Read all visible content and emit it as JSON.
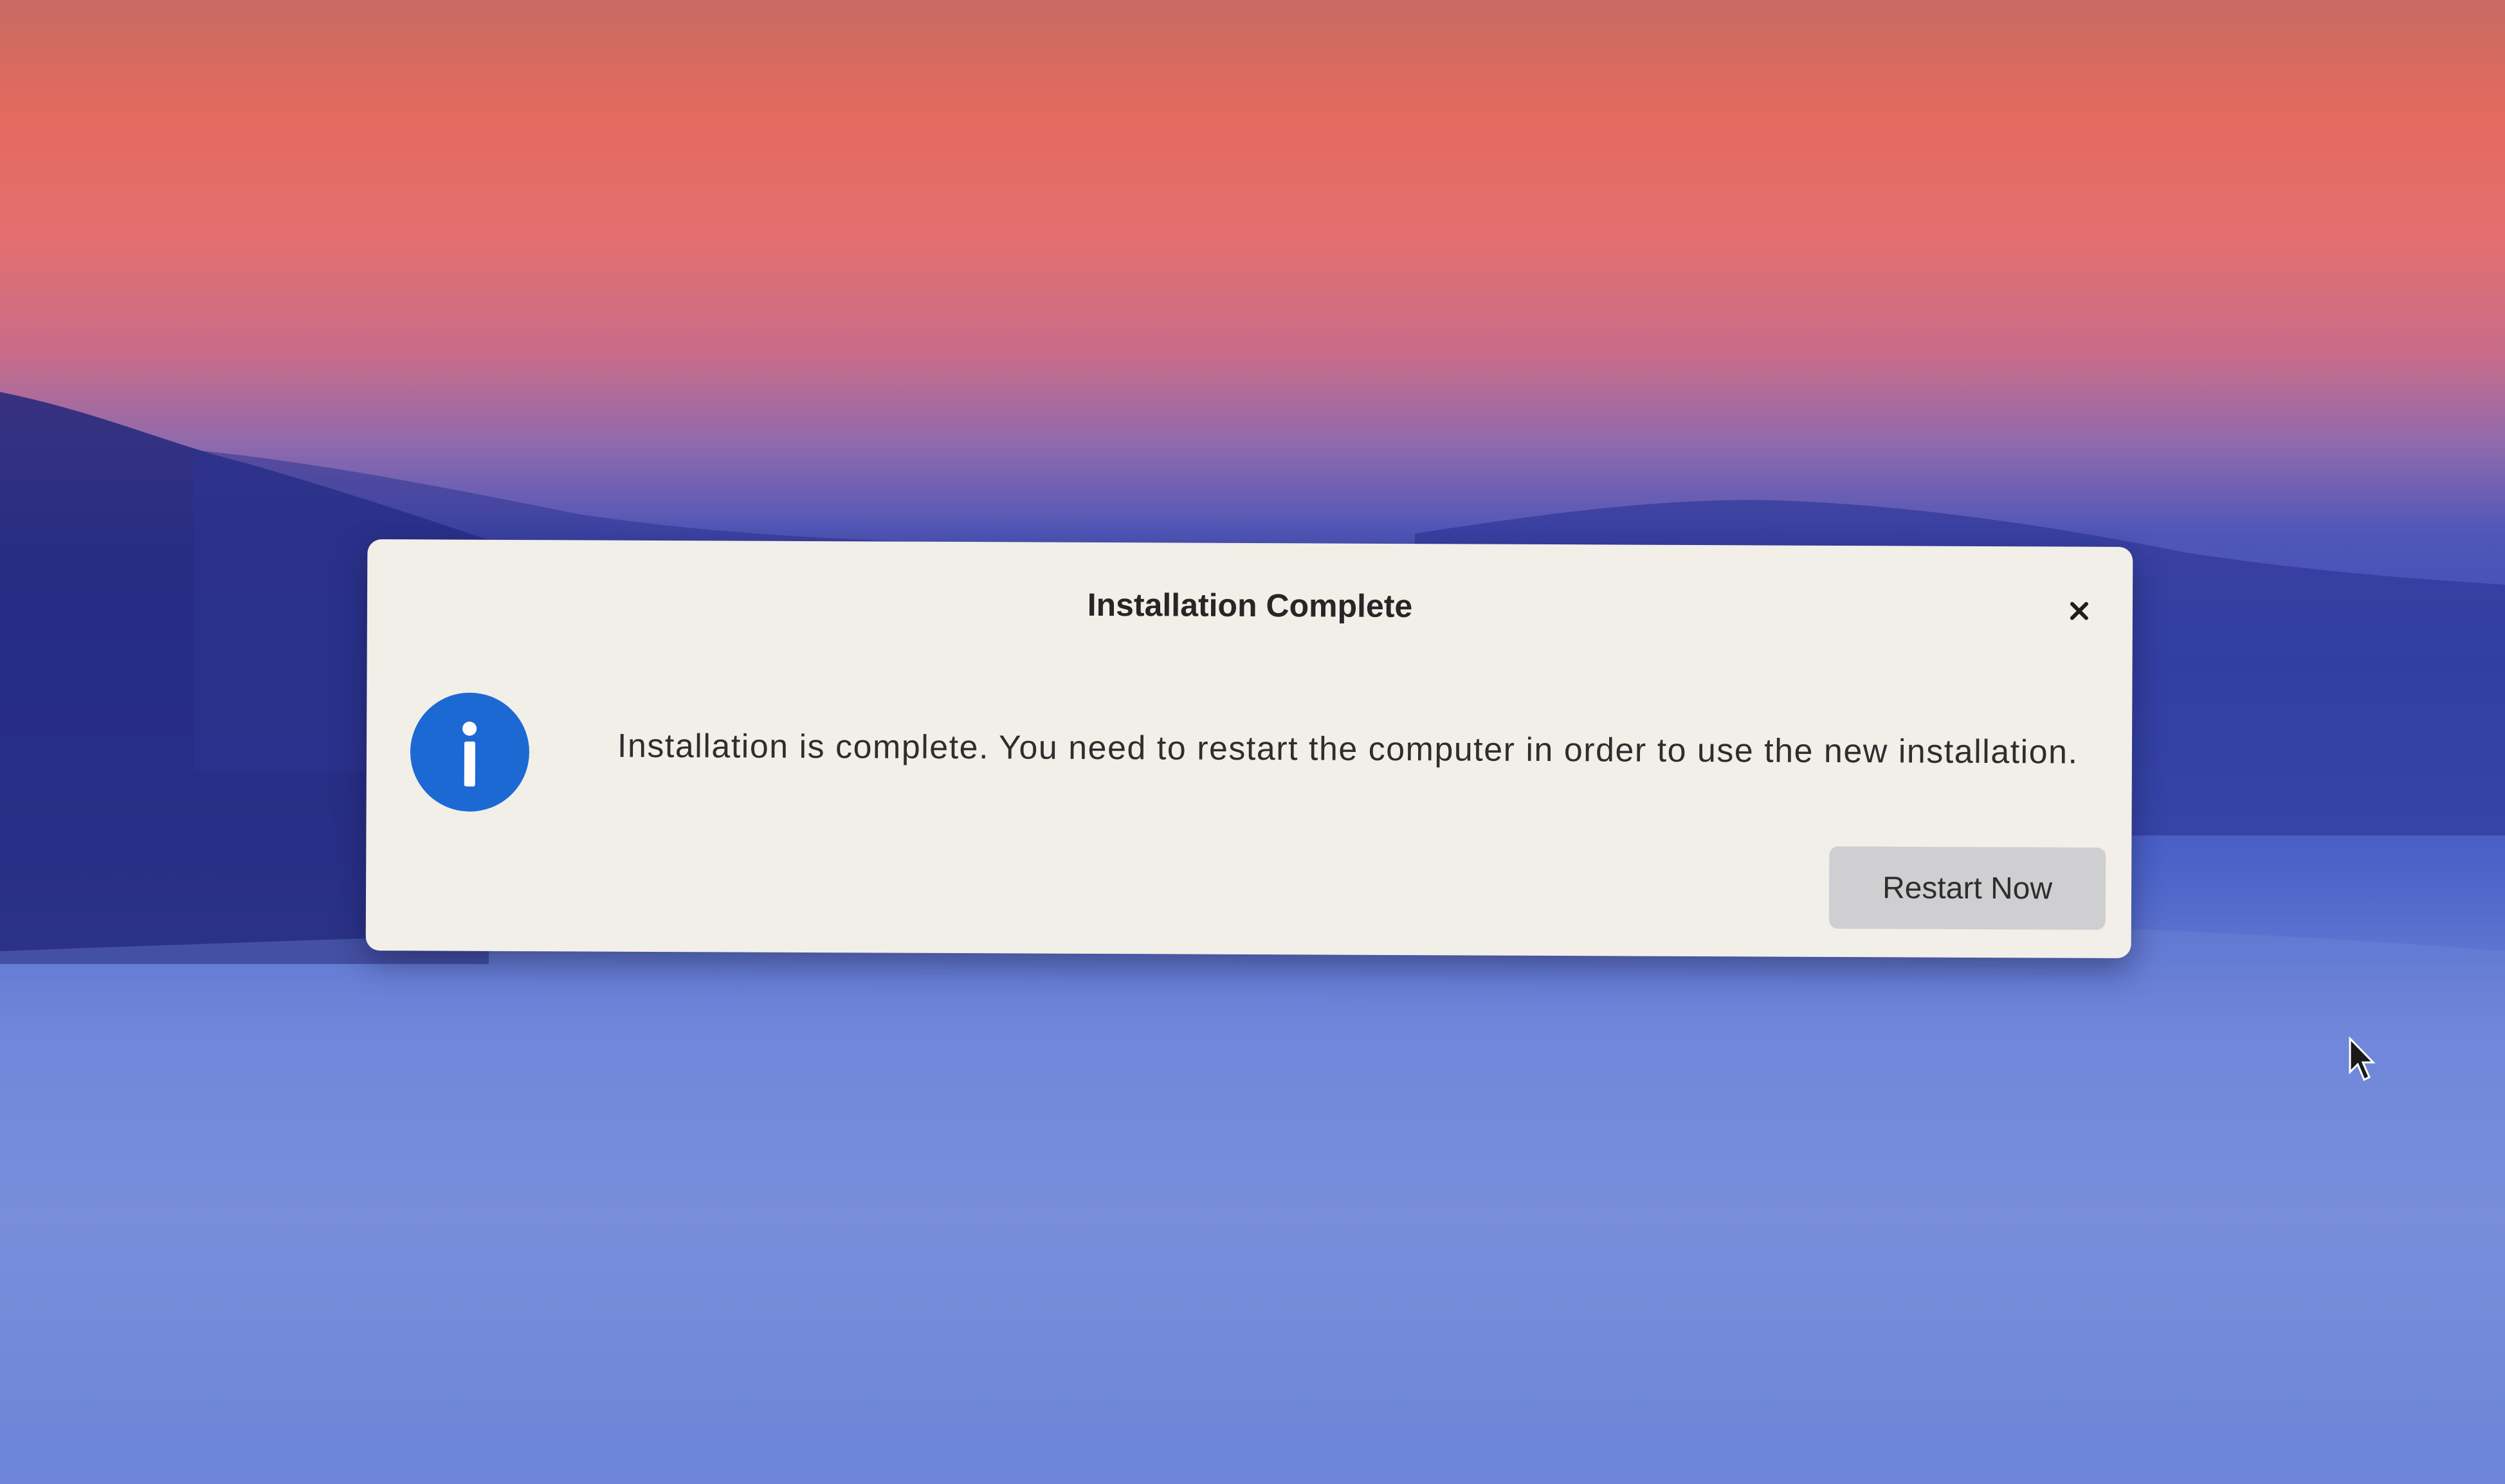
{
  "dialog": {
    "title": "Installation Complete",
    "message": "Installation is complete. You need to restart the computer in order to use the new installation.",
    "restart_label": "Restart Now",
    "close_label": "×"
  },
  "icons": {
    "info": "info-icon",
    "close": "close-icon",
    "cursor": "mouse-pointer-icon"
  },
  "colors": {
    "info_icon": "#1d69d3",
    "dialog_bg": "#f1efe8",
    "button_bg": "#cfcfd2"
  }
}
